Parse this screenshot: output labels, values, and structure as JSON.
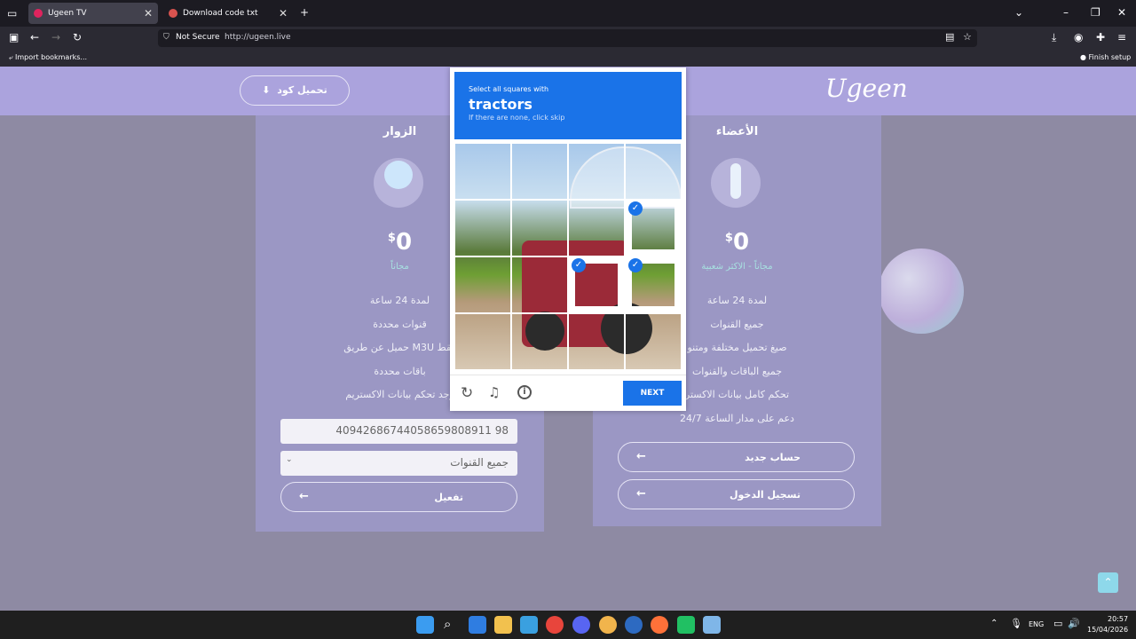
{
  "tabs": [
    {
      "label": "Ugeen TV",
      "active": true
    },
    {
      "label": "Download code txt",
      "active": false
    }
  ],
  "address": {
    "security": "Not Secure",
    "url": "http://ugeen.live"
  },
  "bookmarks": {
    "import": "Import bookmarks...",
    "finish": "Finish setup"
  },
  "site": {
    "logo": "Ugeen",
    "download_button": "تحميل كود",
    "members_card": {
      "title": "الأعضاء",
      "price_symbol": "$",
      "price": "0",
      "subtitle": "مجاناً - الاكثر شعبية",
      "features": [
        "لمدة 24 ساعة",
        "جميع القنوات",
        "صيغ تحميل مختلفة ومتنو",
        "جميع الباقات والقنوات",
        "تحكم كامل بيانات الاكستر",
        "دعم على مدار الساعة 24/7"
      ],
      "signup": "حساب جديد",
      "login": "تسجيل الدخول"
    },
    "visitors_card": {
      "title": "الزوار",
      "price_symbol": "$",
      "price": "0",
      "subtitle": "مجاناً",
      "features": [
        "لمدة 24 ساعة",
        "قنوات محددة",
        "حميل عن طريق M3U فقط",
        "باقات محددة",
        "وجد تحكم بيانات الاكستريم"
      ],
      "code_value": "40942686744058659808911 98",
      "select_value": "جميع القنوات",
      "activate": "تفعيل"
    }
  },
  "captcha": {
    "prompt": "Select all squares with",
    "target": "tractors",
    "hint": "If there are none, click skip",
    "next": "NEXT",
    "selected_cells": [
      7,
      10,
      11
    ]
  },
  "taskbar": {
    "lang": "ENG",
    "time": "20:57",
    "date": "15/04/2026"
  },
  "colors": {
    "accent": "#1a73e8",
    "header": "#aba3dd"
  }
}
